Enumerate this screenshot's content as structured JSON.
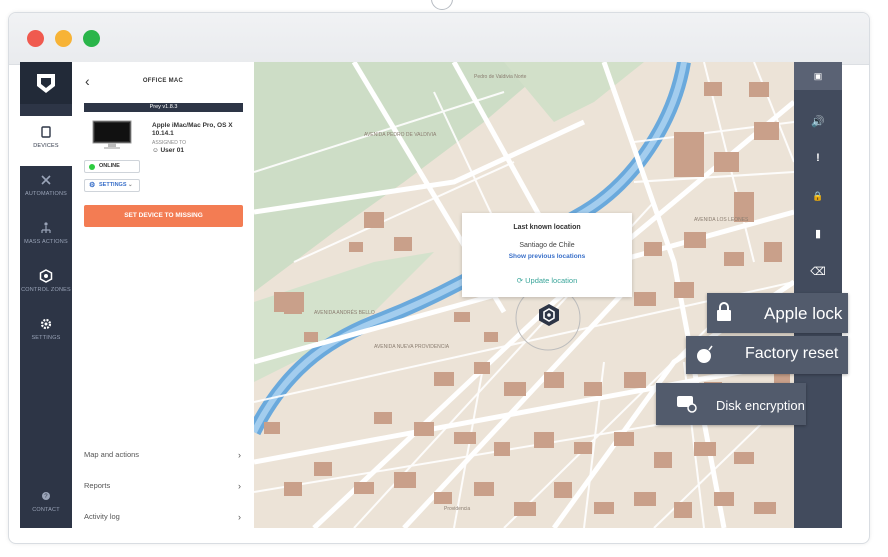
{
  "window": {
    "controls": [
      "close",
      "minimize",
      "maximize"
    ],
    "colors": {
      "close": "#f05a4f",
      "minimize": "#f7b336",
      "maximize": "#2ab54a"
    }
  },
  "sidebar": {
    "items": [
      {
        "label": "DEVICES",
        "icon": "device-icon",
        "active": true
      },
      {
        "label": "AUTOMATIONS",
        "icon": "tools-icon"
      },
      {
        "label": "MASS ACTIONS",
        "icon": "mass-actions-icon"
      },
      {
        "label": "CONTROL ZONES",
        "icon": "control-zones-icon"
      },
      {
        "label": "SETTINGS",
        "icon": "gear-icon"
      },
      {
        "label": "CONTACT",
        "icon": "help-icon"
      }
    ]
  },
  "panel": {
    "title": "OFFICE MAC",
    "version": "Prey v1.8.3",
    "device_name": "Apple iMac/Mac Pro, OS X 10.14.1",
    "assigned_label": "ASSIGNED TO",
    "user": "User 01",
    "status": "ONLINE",
    "settings": "SETTINGS",
    "missing_button": "SET DEVICE TO MISSING",
    "links": [
      "Map and actions",
      "Reports",
      "Activity log"
    ]
  },
  "map": {
    "popup": {
      "title": "Last known location",
      "place": "Santiago de Chile",
      "show_previous": "Show previous locations",
      "update": "Update location"
    },
    "street_labels": [
      "AVENIDA PEDRO DE VALDIVIA",
      "AVENIDA LOS LEONES",
      "AVENIDA NUEVA PROVIDENCIA",
      "AVENIDA ANDRÉS BELLO",
      "Pedro de Valdivia Norte",
      "Providencia"
    ]
  },
  "actions": {
    "toolbar_icons": [
      "expand-icon",
      "alarm-icon",
      "alert-icon",
      "lock-icon",
      "folder-icon",
      "trash-icon"
    ],
    "apple_lock": "Apple lock",
    "factory_reset": "Factory reset",
    "disk_encryption": "Disk encryption"
  }
}
